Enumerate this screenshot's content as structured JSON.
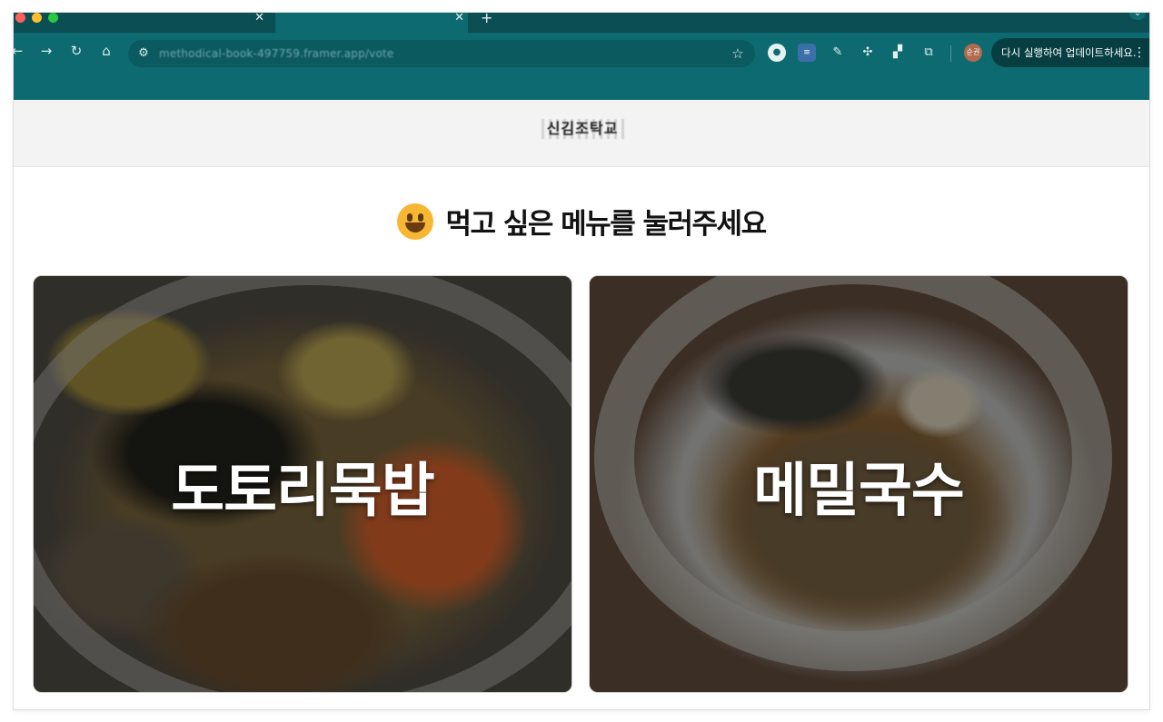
{
  "browser": {
    "tabs": [
      {
        "close_glyph": "✕"
      },
      {
        "close_glyph": "✕"
      }
    ],
    "new_tab_glyph": "+",
    "tab_search_glyph": "⌄",
    "url": "methodical-book-497759.framer.app/vote",
    "profile_initials": "순권",
    "update_button_label": "다시 실행하여 업데이트하세요.",
    "more_glyph": "⋮",
    "icons": [
      "back-icon",
      "forward-icon",
      "reload-icon",
      "home-icon",
      "site-settings-icon",
      "bookmark-star-icon",
      "extension-icons",
      "puzzle-icon",
      "profile-avatar",
      "more-menu-icon"
    ]
  },
  "site": {
    "logo_text": "신김조탁교"
  },
  "page": {
    "heading": "먹고 싶은 메뉴를 눌러주세요",
    "heading_emoji": "grinning-face-emoji",
    "menu_items": [
      {
        "label": "도토리묵밥"
      },
      {
        "label": "메밀국수"
      }
    ]
  },
  "colors": {
    "browser_frame": "#0d6a70",
    "tab_strip": "#0b4f55",
    "header_bg": "#f3f3f4",
    "heading_text": "#121212"
  }
}
